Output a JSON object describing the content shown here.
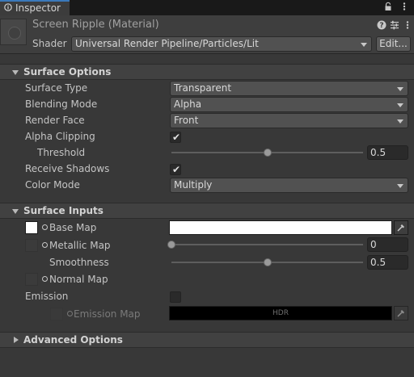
{
  "tab": {
    "label": "Inspector",
    "icon": "info-icon"
  },
  "toolbar": {
    "icons": [
      "lock-icon",
      "kebab-menu-icon"
    ]
  },
  "header": {
    "title": "Screen Ripple (Material)",
    "shader_label": "Shader",
    "shader_value": "Universal Render Pipeline/Particles/Lit",
    "edit_button": "Edit...",
    "icons": [
      "help-icon",
      "preset-icon",
      "context-menu-icon"
    ]
  },
  "surface_options": {
    "title": "Surface Options",
    "surface_type": {
      "label": "Surface Type",
      "value": "Transparent"
    },
    "blending_mode": {
      "label": "Blending Mode",
      "value": "Alpha"
    },
    "render_face": {
      "label": "Render Face",
      "value": "Front"
    },
    "alpha_clipping": {
      "label": "Alpha Clipping",
      "checked": true
    },
    "threshold": {
      "label": "Threshold",
      "value": "0.5",
      "fraction": 0.5
    },
    "receive_shadows": {
      "label": "Receive Shadows",
      "checked": true
    },
    "color_mode": {
      "label": "Color Mode",
      "value": "Multiply"
    }
  },
  "surface_inputs": {
    "title": "Surface Inputs",
    "base_map": {
      "label": "Base Map",
      "color": "#ffffff"
    },
    "metallic_map": {
      "label": "Metallic Map",
      "value": "0",
      "fraction": 0.0
    },
    "smoothness": {
      "label": "Smoothness",
      "value": "0.5",
      "fraction": 0.5
    },
    "normal_map": {
      "label": "Normal Map"
    },
    "emission": {
      "label": "Emission",
      "checked": false
    },
    "emission_map": {
      "label": "Emission Map",
      "color": "#000000",
      "hdr_label": "HDR"
    }
  },
  "advanced_options": {
    "title": "Advanced Options"
  },
  "colors": {
    "accent": "#3a79bb",
    "panel": "#383838",
    "field": "#2a2a2a"
  }
}
